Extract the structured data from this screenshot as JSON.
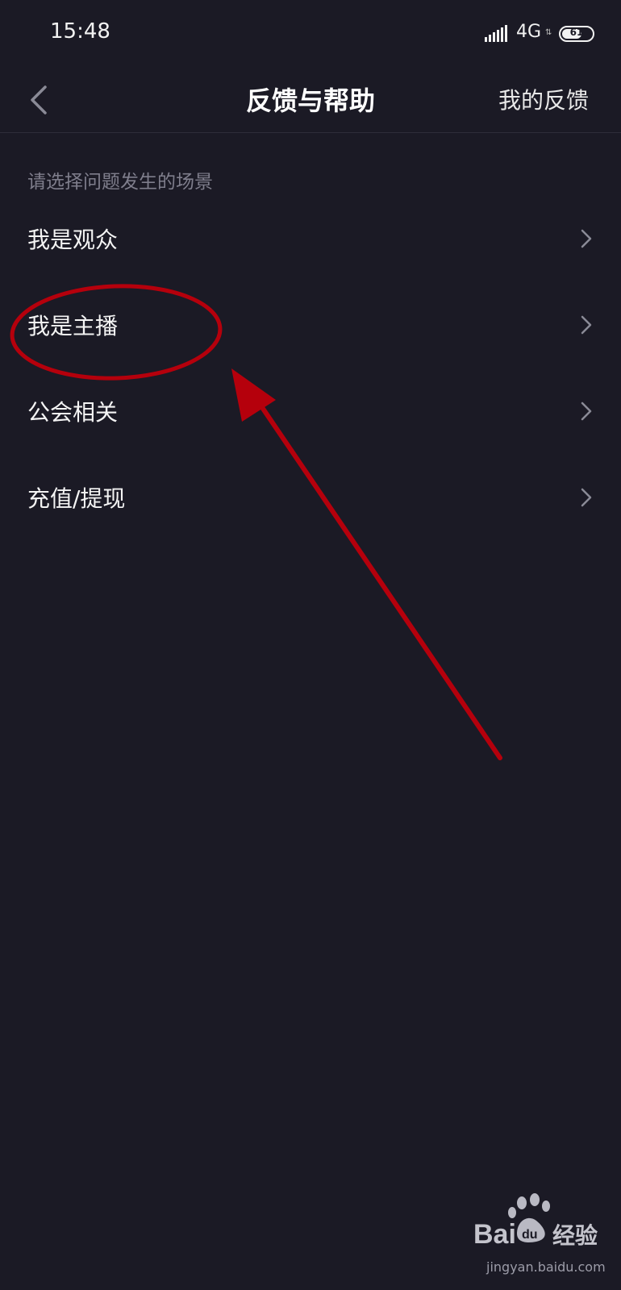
{
  "status_bar": {
    "time": "15:48",
    "network": "4G",
    "battery": "61"
  },
  "header": {
    "title": "反馈与帮助",
    "right_action": "我的反馈",
    "back_icon": "chevron-left-icon"
  },
  "section_label": "请选择问题发生的场景",
  "scenes": [
    {
      "label": "我是观众"
    },
    {
      "label": "我是主播"
    },
    {
      "label": "公会相关"
    },
    {
      "label": "充值/提现"
    }
  ],
  "annotation": {
    "color": "#b5000c",
    "highlighted_item": "我是主播"
  },
  "watermark": {
    "logo": "Baidu经验",
    "url": "jingyan.baidu.com"
  },
  "colors": {
    "background": "#1b1a25",
    "secondary_text": "#7f7e8c"
  }
}
